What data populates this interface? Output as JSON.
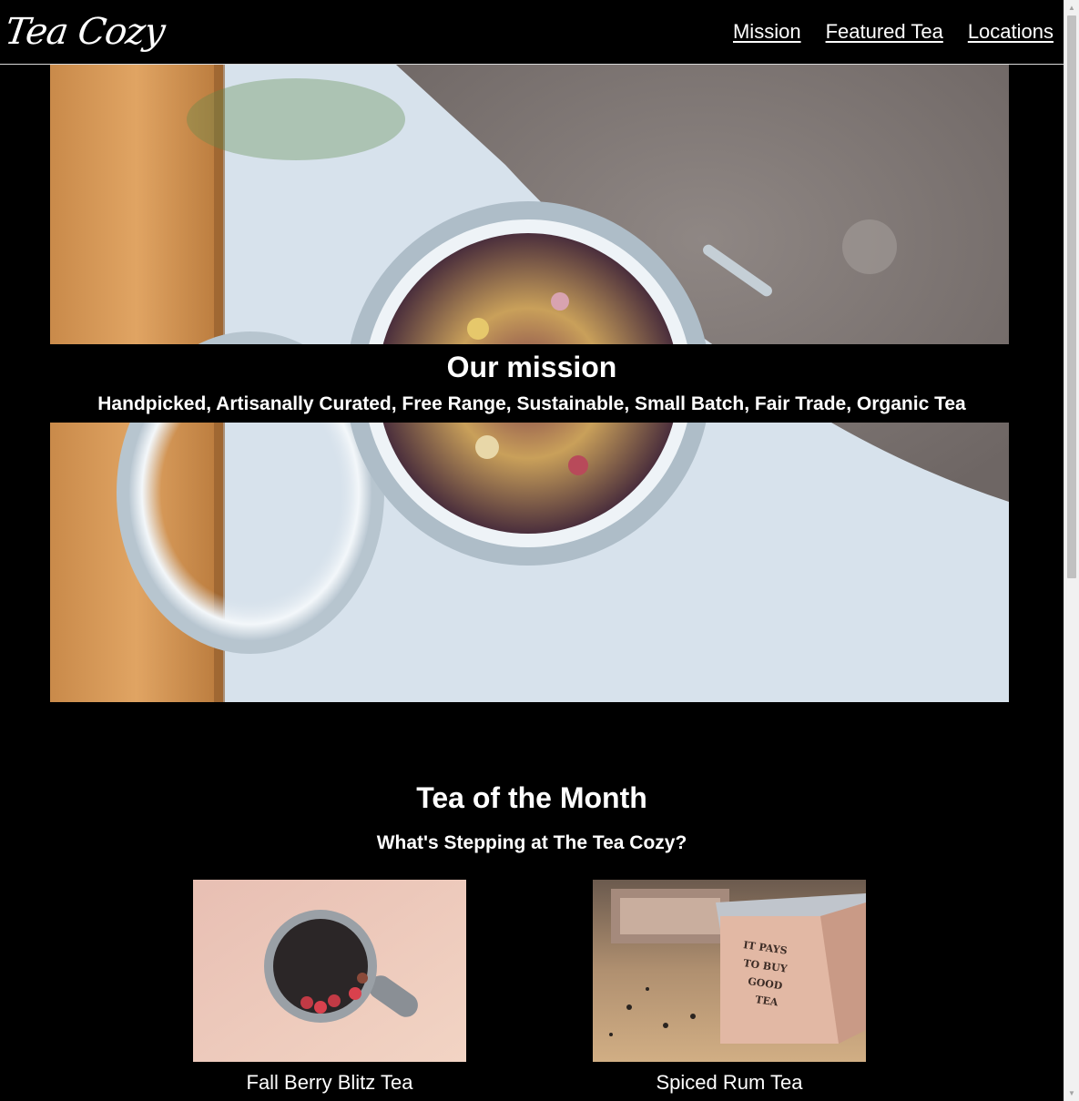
{
  "header": {
    "logo_text": "Tea Cozy",
    "nav": [
      {
        "label": "Mission"
      },
      {
        "label": "Featured Tea"
      },
      {
        "label": "Locations"
      }
    ]
  },
  "mission": {
    "title": "Our mission",
    "subtitle": "Handpicked, Artisanally Curated, Free Range, Sustainable, Small Batch, Fair Trade, Organic Tea"
  },
  "tea_of_month": {
    "title": "Tea of the Month",
    "subtitle": "What's Stepping at The Tea Cozy?",
    "items": [
      {
        "name": "Fall Berry Blitz Tea"
      },
      {
        "name": "Spiced Rum Tea"
      }
    ]
  },
  "tea_box_text": "IT PAYS TO BUY GOOD TEA",
  "scrollbar": {
    "up_icon": "triangle-up-icon",
    "down_icon": "triangle-down-icon"
  }
}
